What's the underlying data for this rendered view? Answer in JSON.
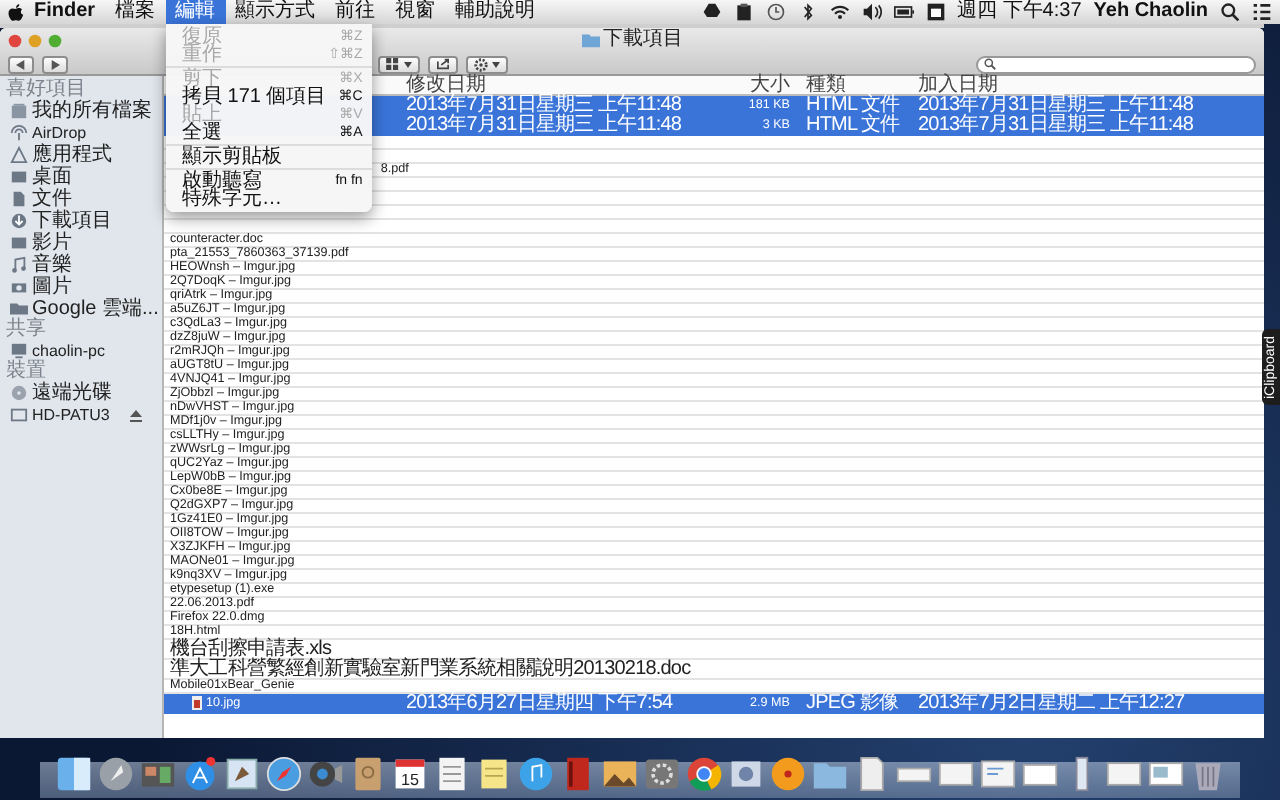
{
  "menu_bar": {
    "menus": [
      {
        "label": "Finder",
        "kind": "app",
        "selected": false
      },
      {
        "label": "檔案",
        "kind": "menu",
        "selected": false
      },
      {
        "label": "編輯",
        "kind": "menu",
        "selected": true
      },
      {
        "label": "顯示方式",
        "kind": "menu",
        "selected": false
      },
      {
        "label": "前往",
        "kind": "menu",
        "selected": false
      },
      {
        "label": "視窗",
        "kind": "menu",
        "selected": false
      },
      {
        "label": "輔助說明",
        "kind": "menu",
        "selected": false
      }
    ],
    "clock": "週四 下午4:37",
    "user": "Yeh Chaolin"
  },
  "edit_menu": [
    {
      "kind": "item",
      "label": "復原",
      "shortcut": "⌘Z",
      "disabled": true
    },
    {
      "kind": "item",
      "label": "重作",
      "shortcut": "⇧⌘Z",
      "disabled": true
    },
    {
      "kind": "separator"
    },
    {
      "kind": "item",
      "label": "剪下",
      "shortcut": "⌘X",
      "disabled": true
    },
    {
      "kind": "item",
      "label": "拷貝 171 個項目",
      "shortcut": "⌘C",
      "disabled": false
    },
    {
      "kind": "item",
      "label": "貼上",
      "shortcut": "⌘V",
      "disabled": true
    },
    {
      "kind": "item",
      "label": "全選",
      "shortcut": "⌘A",
      "disabled": false
    },
    {
      "kind": "separator"
    },
    {
      "kind": "item",
      "label": "顯示剪貼板",
      "disabled": false
    },
    {
      "kind": "separator"
    },
    {
      "kind": "item",
      "label": "啟動聽寫",
      "shortcut": "fn fn",
      "disabled": false
    },
    {
      "kind": "item",
      "label": "特殊字元…",
      "disabled": false
    }
  ],
  "window": {
    "title": "下載項目"
  },
  "sidebar": [
    {
      "heading": "喜好項目",
      "items": [
        {
          "label": "我的所有檔案"
        },
        {
          "label": "AirDrop"
        },
        {
          "label": "應用程式"
        },
        {
          "label": "桌面"
        },
        {
          "label": "文件"
        },
        {
          "label": "下載項目"
        },
        {
          "label": "影片"
        },
        {
          "label": "音樂"
        },
        {
          "label": "圖片"
        },
        {
          "label": "Google 雲端..."
        }
      ]
    },
    {
      "heading": "共享",
      "items": [
        {
          "label": "chaolin-pc"
        }
      ]
    },
    {
      "heading": "裝置",
      "items": [
        {
          "label": "遠端光碟",
          "ejectable": false
        },
        {
          "label": "HD-PATU3",
          "ejectable": true
        }
      ]
    }
  ],
  "columns": [
    "修改日期",
    "大小",
    "種類",
    "加入日期"
  ],
  "rows": [
    {
      "kind": "covered",
      "selected": true,
      "modified": "2013年7月31日星期三 上午11:48",
      "size": "181 KB",
      "type": "HTML 文件",
      "added": "2013年7月31日星期三 上午11:48"
    },
    {
      "kind": "covered",
      "selected": true,
      "modified": "2013年7月31日星期三 上午11:48",
      "size": "3 KB",
      "type": "HTML 文件",
      "added": "2013年7月31日星期三 上午11:48"
    },
    {
      "kind": "covered",
      "selected": false
    },
    {
      "kind": "covered",
      "selected": false
    },
    {
      "kind": "clipped",
      "selected": false,
      "name": "8.pdf"
    },
    {
      "kind": "covered",
      "selected": false
    },
    {
      "kind": "covered",
      "selected": false
    },
    {
      "kind": "covered",
      "selected": false
    },
    {
      "kind": "covered",
      "selected": false
    },
    {
      "kind": "plain",
      "selected": false,
      "name": "counteracter.doc"
    },
    {
      "kind": "plain",
      "selected": false,
      "name": "pta_21553_7860363_37139.pdf"
    },
    {
      "kind": "plain",
      "selected": false,
      "name": "HEOWnsh – Imgur.jpg"
    },
    {
      "kind": "plain",
      "selected": false,
      "name": "2Q7DoqK – Imgur.jpg"
    },
    {
      "kind": "plain",
      "selected": false,
      "name": "qriAtrk – Imgur.jpg"
    },
    {
      "kind": "plain",
      "selected": false,
      "name": "a5uZ6JT – Imgur.jpg"
    },
    {
      "kind": "plain",
      "selected": false,
      "name": "c3QdLa3 – Imgur.jpg"
    },
    {
      "kind": "plain",
      "selected": false,
      "name": "dzZ8juW – Imgur.jpg"
    },
    {
      "kind": "plain",
      "selected": false,
      "name": "r2mRJQh – Imgur.jpg"
    },
    {
      "kind": "plain",
      "selected": false,
      "name": "aUGT8tU – Imgur.jpg"
    },
    {
      "kind": "plain",
      "selected": false,
      "name": "4VNJQ41 – Imgur.jpg"
    },
    {
      "kind": "plain",
      "selected": false,
      "name": "ZjObbzl – Imgur.jpg"
    },
    {
      "kind": "plain",
      "selected": false,
      "name": "nDwVHST – Imgur.jpg"
    },
    {
      "kind": "plain",
      "selected": false,
      "name": "MDf1j0v – Imgur.jpg"
    },
    {
      "kind": "plain",
      "selected": false,
      "name": "csLLTHy – Imgur.jpg"
    },
    {
      "kind": "plain",
      "selected": false,
      "name": "zWWsrLg – Imgur.jpg"
    },
    {
      "kind": "plain",
      "selected": false,
      "name": "qUC2Yaz – Imgur.jpg"
    },
    {
      "kind": "plain",
      "selected": false,
      "name": "LepW0bB – Imgur.jpg"
    },
    {
      "kind": "plain",
      "selected": false,
      "name": "Cx0be8E – Imgur.jpg"
    },
    {
      "kind": "plain",
      "selected": false,
      "name": "Q2dGXP7 – Imgur.jpg"
    },
    {
      "kind": "plain",
      "selected": false,
      "name": "1Gz41E0 – Imgur.jpg"
    },
    {
      "kind": "plain",
      "selected": false,
      "name": "OII8TOW – Imgur.jpg"
    },
    {
      "kind": "plain",
      "selected": false,
      "name": "X3ZJKFH – Imgur.jpg"
    },
    {
      "kind": "plain",
      "selected": false,
      "name": "MAONe01 – Imgur.jpg"
    },
    {
      "kind": "plain",
      "selected": false,
      "name": "k9nq3XV – Imgur.jpg"
    },
    {
      "kind": "plain",
      "selected": false,
      "name": "etypesetup (1).exe"
    },
    {
      "kind": "plain",
      "selected": false,
      "name": "22.06.2013.pdf"
    },
    {
      "kind": "plain",
      "selected": false,
      "name": "Firefox 22.0.dmg"
    },
    {
      "kind": "plain",
      "selected": false,
      "name": "18H.html"
    },
    {
      "kind": "plain",
      "selected": false,
      "name": "機台刮擦申請表.xls"
    },
    {
      "kind": "plain",
      "selected": false,
      "name": "準大工科營繁經創新實驗室新門業系統相關說明20130218.doc"
    },
    {
      "kind": "plain",
      "selected": false,
      "name": "Mobile01xBear_Genie"
    },
    {
      "kind": "with_icon",
      "selected": true,
      "name": "10.jpg",
      "modified": "2013年6月27日星期四 下午7:54",
      "size": "2.9 MB",
      "type": "JPEG 影像",
      "added": "2013年7月2日星期二 上午12:27"
    }
  ],
  "side_tab": {
    "label": "iClipboard"
  },
  "dock": {
    "calendar_day": "15"
  }
}
